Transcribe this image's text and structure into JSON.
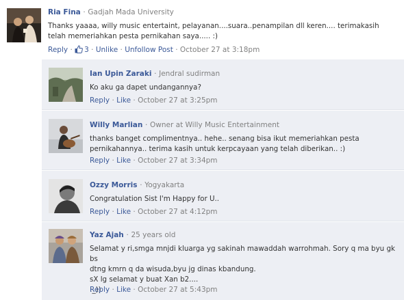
{
  "post": {
    "author": "Ria Fina",
    "network": "Gadjah Mada University",
    "text": "Thanks yaaaa, willy music entertaint, pelayanan....suara..penampilan dll keren.... terimakasih telah memeriahkan pesta pernikahan saya..... :)",
    "actions": {
      "reply": "Reply",
      "like_count": "3",
      "unlike": "Unlike",
      "unfollow": "Unfollow Post",
      "time": "October 27 at 3:18pm"
    }
  },
  "separator": "·",
  "replies": [
    {
      "author": "Ian Upin Zaraki",
      "network": "Jendral sudirman",
      "lines": [
        "Ko aku ga dapet undangannya?"
      ],
      "reply": "Reply",
      "like": "Like",
      "time": "October 27 at 3:25pm"
    },
    {
      "author": "Willy Marlian",
      "network": "Owner at Willy Music Entertainment",
      "lines": [
        "thanks banget complimentnya.. hehe.. senang bisa ikut memeriahkan pesta",
        "pernikahannya.. terima kasih untuk kerpcayaan yang telah diberikan.. :)"
      ],
      "reply": "Reply",
      "like": "Like",
      "time": "October 27 at 3:34pm"
    },
    {
      "author": "Ozzy Morris",
      "network": "Yogyakarta",
      "lines": [
        "Congratulation Sist I'm Happy for U.."
      ],
      "reply": "Reply",
      "like": "Like",
      "time": "October 27 at 4:12pm"
    },
    {
      "author": "Yaz Ajah",
      "network": "25 years old",
      "lines": [
        "Selamat y ri,smga mnjdi kluarga yg sakinah mawaddah warrohmah. Sory q ma byu gk bs",
        "dtng kmrn q da wisuda,byu jg dinas kbandung.",
        "sX lg selamat y buat Xan b2....",
        ":_))"
      ],
      "reply": "Reply",
      "like": "Like",
      "time": "October 27 at 5:43pm"
    }
  ],
  "colors": {
    "link": "#3b5998",
    "meta": "#808080",
    "reply_bg": "#edeff4"
  }
}
